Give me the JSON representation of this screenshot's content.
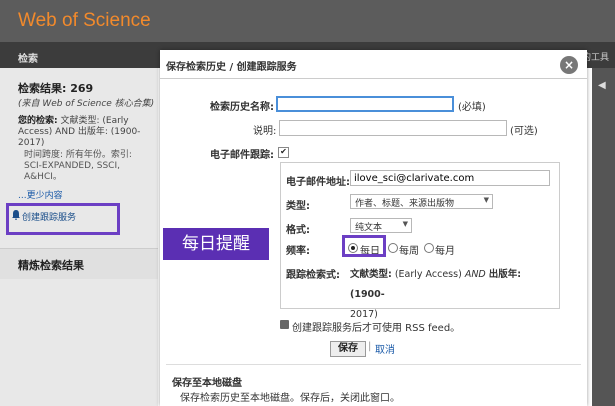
{
  "app": {
    "brand": "Web of Science",
    "nav_search": "检索",
    "nav_tools": "我的工具"
  },
  "left_panel": {
    "results": "检索结果: 269",
    "source": "(来自 Web of Science 核心合集)",
    "query_label": "您的检索:",
    "query_text": "文献类型: (Early Access) AND 出版年: (1900-2017)",
    "timespan": "时间跨度: 所有年份。索引: SCI-EXPANDED, SSCI, A&HCI。",
    "less": "...更少内容",
    "create_alert": "创建跟踪服务",
    "refine": "精炼检索结果"
  },
  "dialog": {
    "title": "保存检索历史 / 创建跟踪服务",
    "name_label": "检索历史名称:",
    "name_value": "",
    "required": "(必填)",
    "desc_label": "说明:",
    "desc_value": "",
    "optional": "(可选)",
    "email_alert_label": "电子邮件跟踪:",
    "email_alert_checked": "✔",
    "email_label": "电子邮件地址:",
    "email_value": "ilove_sci@clarivate.com",
    "type_label": "类型:",
    "type_value": "作者、标题、来源出版物",
    "format_label": "格式:",
    "format_value": "纯文本",
    "freq_label": "频率:",
    "freq_options": [
      "每日",
      "每周",
      "每月"
    ],
    "freq_selected": "每日",
    "query_label": "跟踪检索式:",
    "query_value_prefix": "文献类型:",
    "query_value_1": "(Early Access)",
    "query_value_and": "AND",
    "query_value_2": "出版年: (1900-",
    "query_value_3": "2017)",
    "rss_text": "创建跟踪服务后才可使用 RSS feed。",
    "save": "保存",
    "separator": "|",
    "cancel": "取消",
    "save_local_title": "保存至本地磁盘",
    "save_local_desc": "保存检索历史至本地磁盘。保存后，关闭此窗口。",
    "close": "×"
  },
  "callout": "每日提醒",
  "colors": {
    "brand": "#f28a2c",
    "highlight": "#6c3fc4",
    "callout_bg": "#5b2fb3"
  }
}
